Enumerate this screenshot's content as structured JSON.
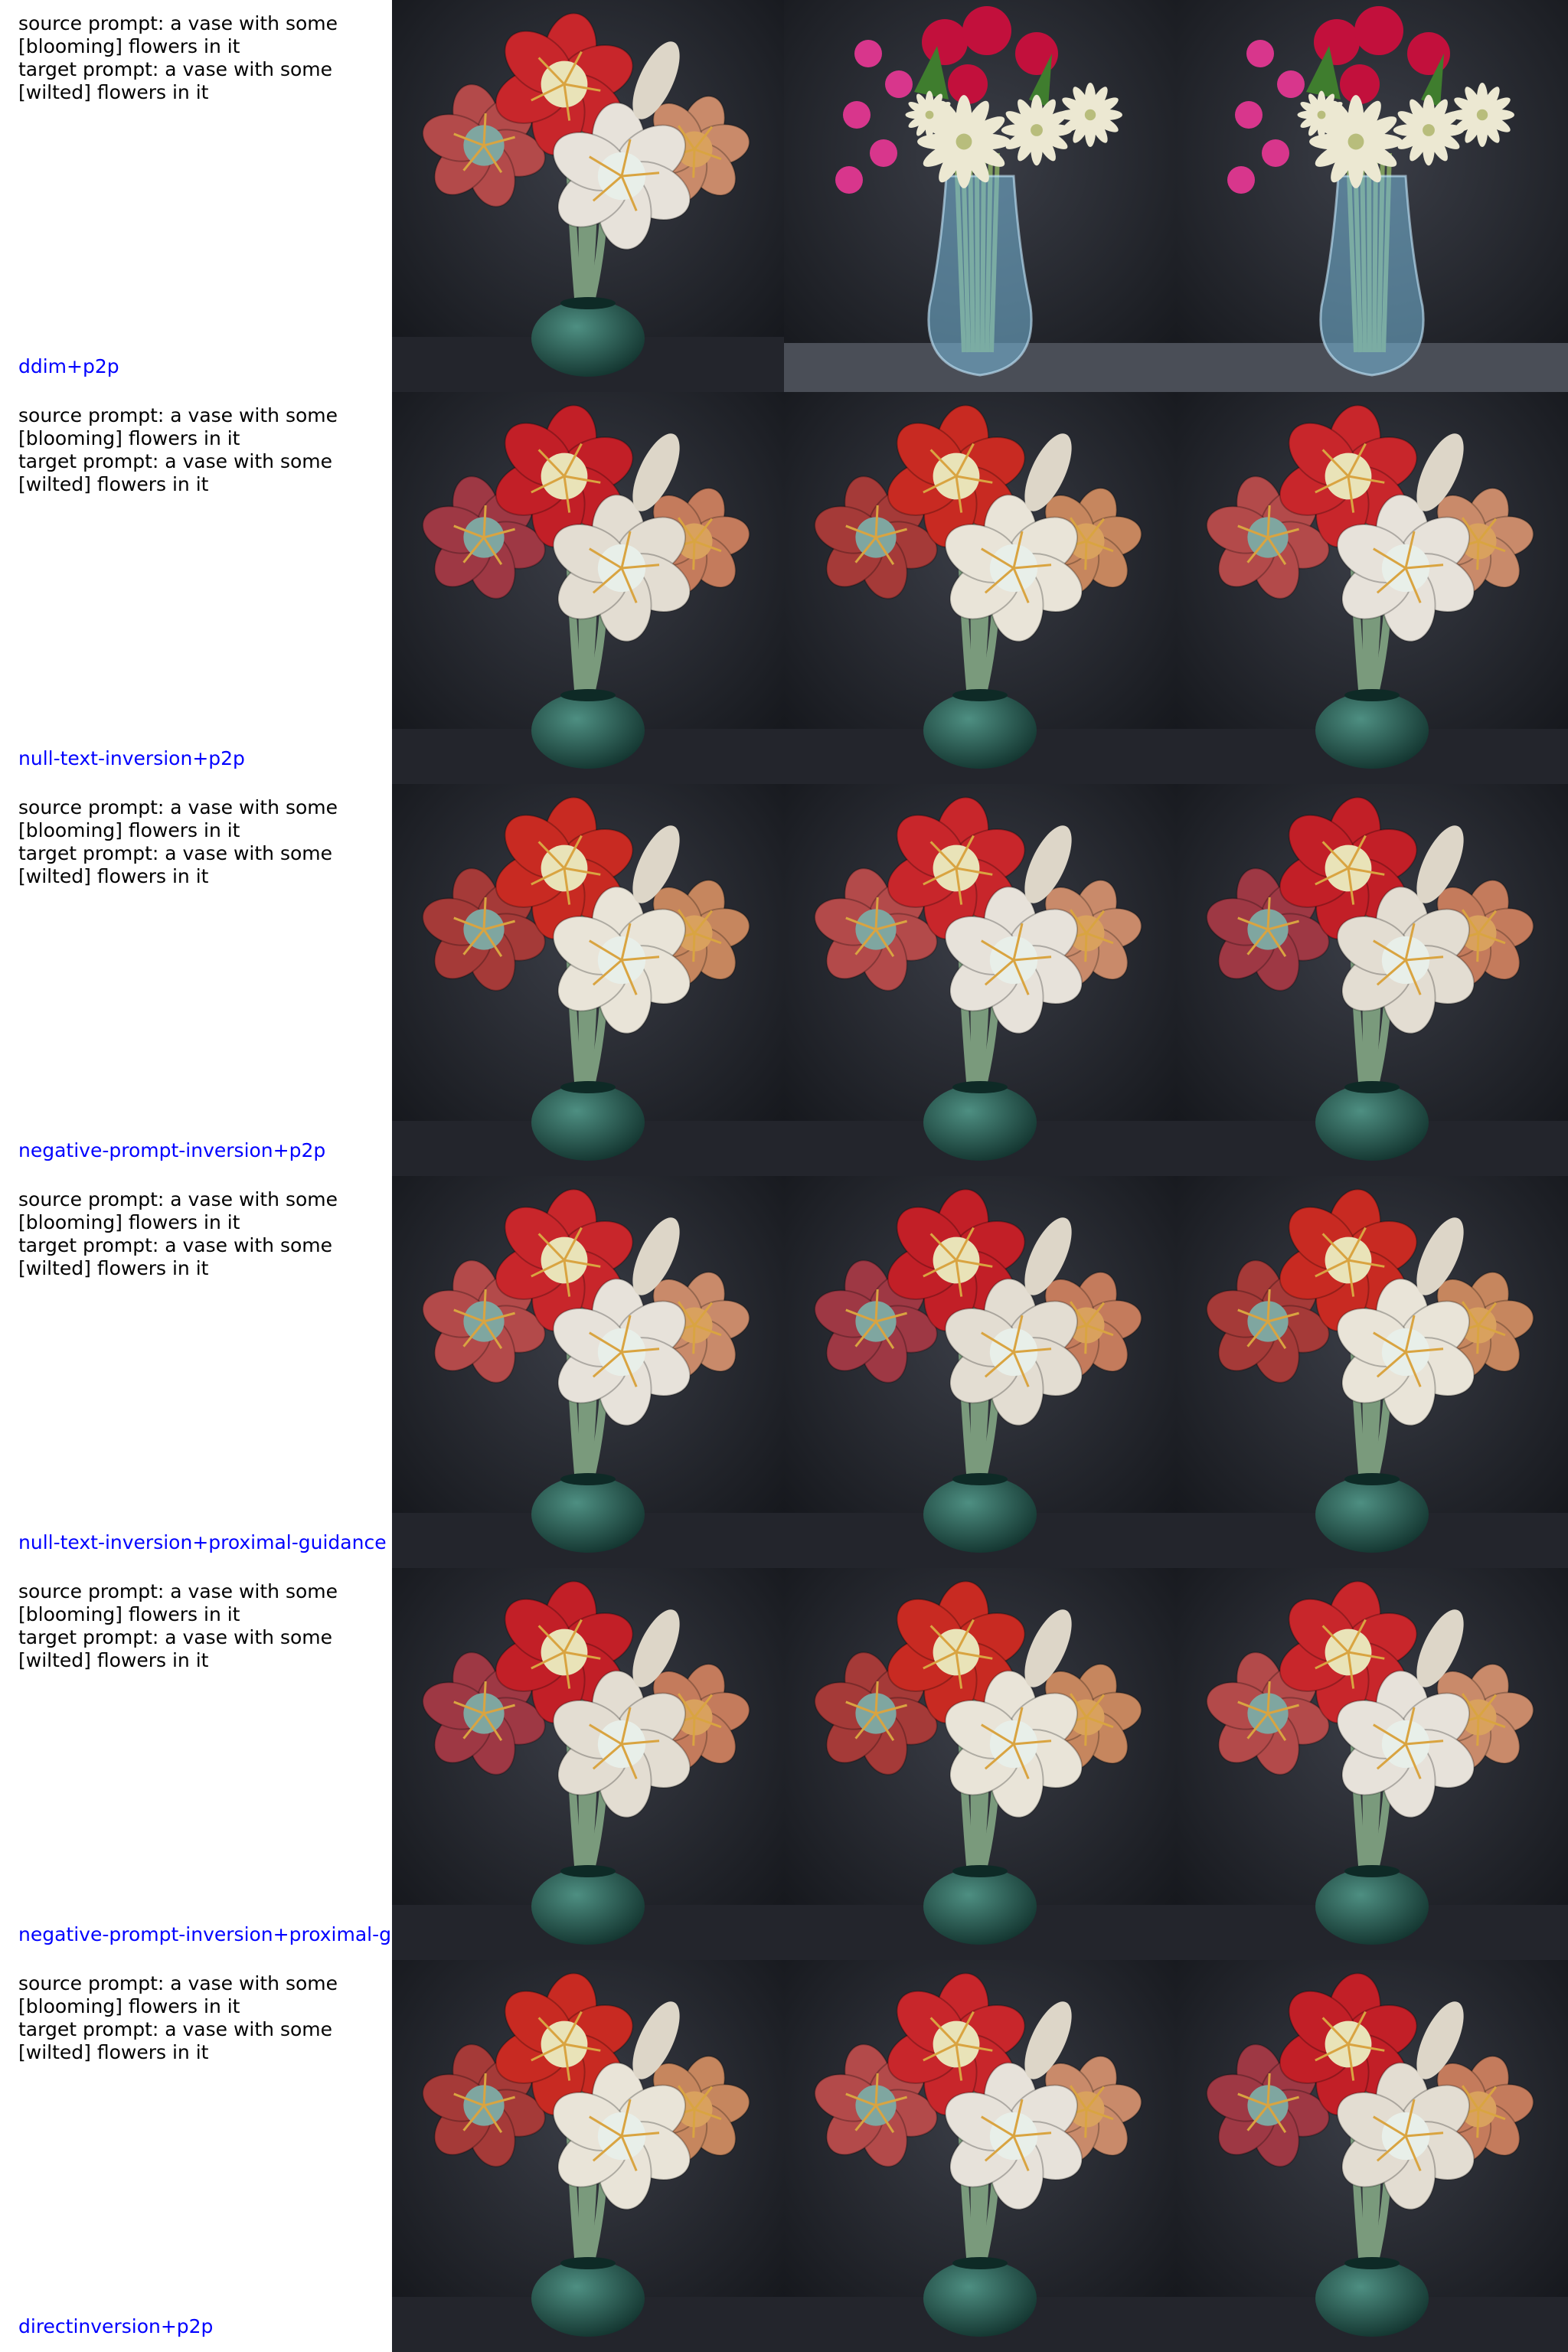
{
  "grid": {
    "rows": [
      {
        "source_prompt": "source prompt: a vase with some [blooming] flowers in it",
        "target_prompt": "target prompt: a vase with some [wilted] flowers in it",
        "method": "ddim+p2p",
        "images": [
          {
            "desc": "amaryllis-bouquet-green-vase"
          },
          {
            "desc": "pink-white-bouquet-blue-vase"
          },
          {
            "desc": "pink-white-bouquet-blue-vase"
          }
        ]
      },
      {
        "source_prompt": "source prompt: a vase with some [blooming] flowers in it",
        "target_prompt": "target prompt: a vase with some [wilted] flowers in it",
        "method": "null-text-inversion+p2p",
        "images": [
          {
            "desc": "amaryllis-bouquet-green-vase"
          },
          {
            "desc": "amaryllis-bouquet-green-vase"
          },
          {
            "desc": "amaryllis-bouquet-green-vase"
          }
        ]
      },
      {
        "source_prompt": "source prompt: a vase with some [blooming] flowers in it",
        "target_prompt": "target prompt: a vase with some [wilted] flowers in it",
        "method": "negative-prompt-inversion+p2p",
        "images": [
          {
            "desc": "amaryllis-bouquet-green-vase"
          },
          {
            "desc": "amaryllis-bouquet-green-vase"
          },
          {
            "desc": "amaryllis-bouquet-green-vase"
          }
        ]
      },
      {
        "source_prompt": "source prompt: a vase with some [blooming] flowers in it",
        "target_prompt": "target prompt: a vase with some [wilted] flowers in it",
        "method": "null-text-inversion+proximal-guidance",
        "images": [
          {
            "desc": "amaryllis-bouquet-green-vase"
          },
          {
            "desc": "amaryllis-bouquet-green-vase"
          },
          {
            "desc": "amaryllis-bouquet-green-vase"
          }
        ]
      },
      {
        "source_prompt": "source prompt: a vase with some [blooming] flowers in it",
        "target_prompt": "target prompt: a vase with some [wilted] flowers in it",
        "method": "negative-prompt-inversion+proximal-g",
        "images": [
          {
            "desc": "amaryllis-bouquet-green-vase"
          },
          {
            "desc": "amaryllis-bouquet-green-vase"
          },
          {
            "desc": "amaryllis-bouquet-green-vase"
          }
        ]
      },
      {
        "source_prompt": "source prompt: a vase with some [blooming] flowers in it",
        "target_prompt": "target prompt: a vase with some [wilted] flowers in it",
        "method": "directinversion+p2p",
        "images": [
          {
            "desc": "amaryllis-bouquet-green-vase"
          },
          {
            "desc": "amaryllis-bouquet-green-vase"
          },
          {
            "desc": "amaryllis-bouquet-green-vase"
          }
        ]
      }
    ]
  },
  "colors": {
    "method_label": "#0000ff",
    "prompt_text": "#000000",
    "background": "#ffffff"
  }
}
